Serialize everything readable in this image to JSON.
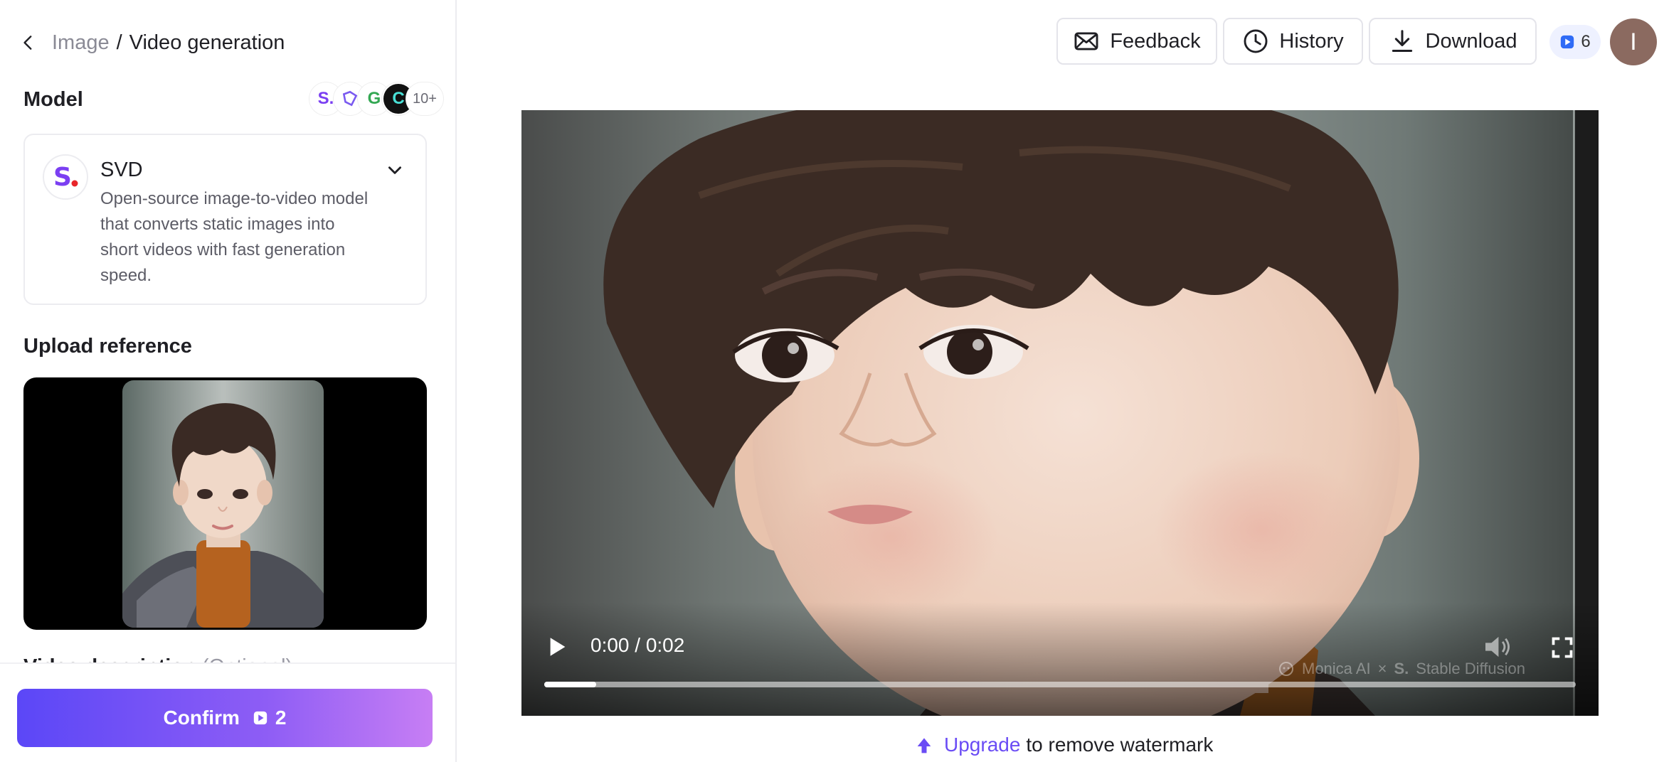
{
  "breadcrumb": {
    "parent": "Image",
    "separator": "/",
    "current": "Video generation"
  },
  "model_section": {
    "label": "Model",
    "logos": [
      "S.",
      "",
      "G",
      "C"
    ],
    "more_count": "10+",
    "selected": {
      "name": "SVD",
      "description": "Open-source image-to-video model that converts static images into short videos with fast generation speed."
    }
  },
  "upload_section": {
    "label": "Upload reference"
  },
  "partial_section": {
    "label": "Video description",
    "note": "(Optional)"
  },
  "confirm": {
    "label": "Confirm",
    "credits": "2"
  },
  "topbar": {
    "feedback": "Feedback",
    "history": "History",
    "download": "Download",
    "credit_count": "6",
    "user_initial": "I"
  },
  "video": {
    "time": "0:00 / 0:02",
    "progress": 0.05,
    "watermark_left": "Monica AI",
    "watermark_x": "×",
    "watermark_right": "Stable Diffusion"
  },
  "upgrade": {
    "link": "Upgrade",
    "text": "to remove watermark"
  },
  "colors": {
    "accent": "#6a4cf5",
    "brand_gradient_start": "#5b47f7",
    "brand_gradient_end": "#c77ef4"
  }
}
